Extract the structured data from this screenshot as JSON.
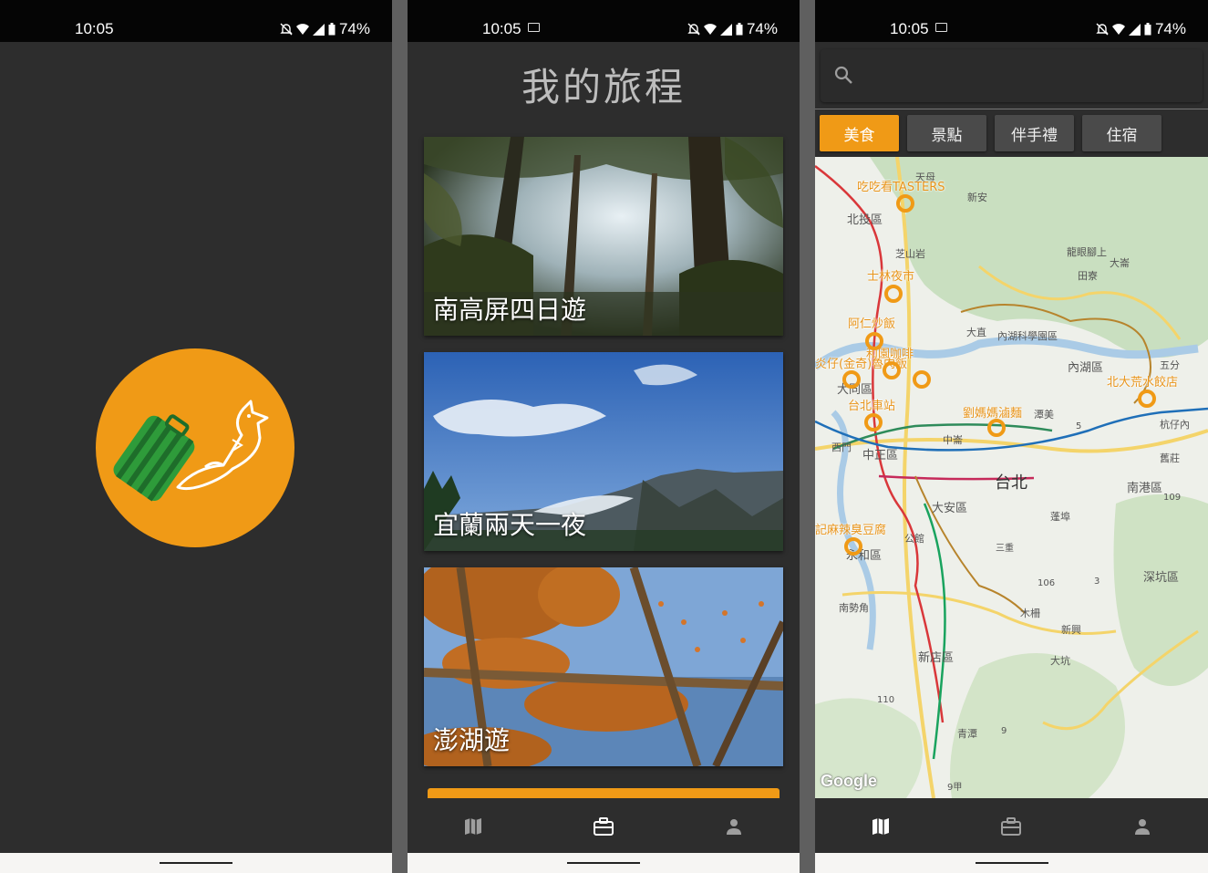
{
  "status_bar": {
    "time": "10:05",
    "battery": "74%"
  },
  "trips_screen": {
    "title": "我的旅程",
    "trips": [
      {
        "label": "南高屏四日遊"
      },
      {
        "label": "宜蘭兩天一夜"
      },
      {
        "label": "澎湖遊"
      }
    ]
  },
  "map_screen": {
    "search": {
      "placeholder": ""
    },
    "categories": [
      "美食",
      "景點",
      "伴手禮",
      "住宿"
    ],
    "active_category": "美食",
    "district_labels": [
      "北投區",
      "芝山岩",
      "天母",
      "新安",
      "龍眼腳上",
      "大崙",
      "田寮",
      "大直",
      "內湖科學園區",
      "內湖區",
      "五分",
      "大同區",
      "潭美",
      "杭仔內",
      "西門",
      "中正區",
      "中崙",
      "舊莊",
      "台北",
      "南港區",
      "大安區",
      "蓬埠",
      "公館",
      "三重",
      "永和區",
      "深坑區",
      "南勢角",
      "木柵",
      "新興",
      "新店區",
      "大坑",
      "青潭",
      "110",
      "106",
      "109",
      "5",
      "3",
      "9",
      "9甲"
    ],
    "poi_labels": [
      "吃吃看TASTERS",
      "士林夜市",
      "阿仁炒飯",
      "和園咖啡",
      "炎仔(金奇)魯肉飯",
      "台北車站",
      "劉媽媽滷麵",
      "北大荒水餃店",
      "記麻辣臭豆腐"
    ],
    "attribution": "Google"
  },
  "bottom_nav": {
    "items": [
      "map-icon",
      "briefcase-icon",
      "person-icon"
    ]
  },
  "colors": {
    "accent": "#f09a16",
    "background": "#2d2d2d",
    "status_bar": "#050505"
  }
}
